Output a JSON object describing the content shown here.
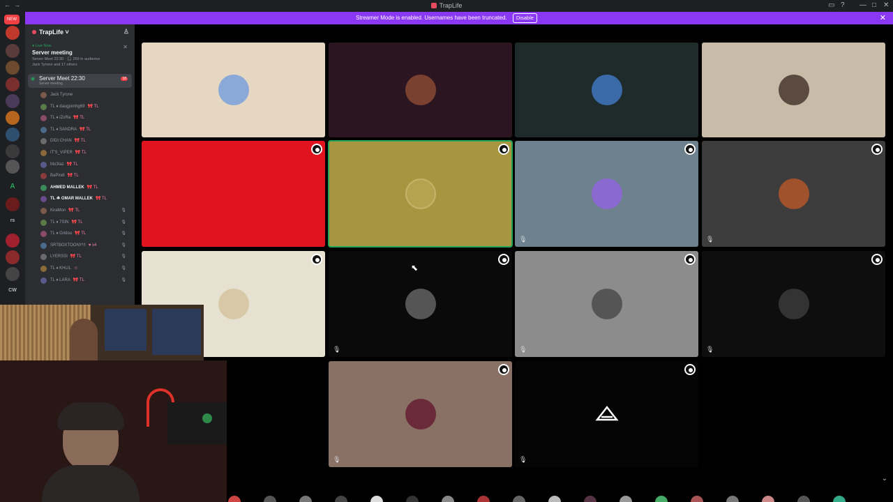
{
  "window": {
    "title": "TrapLife",
    "nav_back": "←",
    "nav_forward": "→",
    "inbox_icon": "inbox-icon",
    "help_icon": "help-icon",
    "minimize": "—",
    "maximize": "□",
    "close": "✕"
  },
  "banner": {
    "text": "Streamer Mode is enabled. Usernames have been truncated.",
    "disable_label": "Disable",
    "close_label": "✕",
    "color": "#8b38f5"
  },
  "server_rail": {
    "new_badge": "NEW",
    "letters": [
      "A",
      "rs",
      "CW"
    ]
  },
  "server": {
    "name": "TrapLife",
    "chevron": "˅",
    "live": {
      "live_now_label": "● Live Now",
      "title": "Server meeting",
      "subtitle": "Server Meet 22:30 · 🎧 269 in audience",
      "speakers": "Jack Tyrone and 17 others",
      "close_label": "✕"
    },
    "voice_channel": {
      "name": "Server Meet 22:30",
      "sub": "Server meeting",
      "badge": "18"
    },
    "members": [
      {
        "name": "Jack Tyrone",
        "tag": ""
      },
      {
        "name": "TL ♦ daugjomhg69",
        "tag": "🎀 TL"
      },
      {
        "name": "TL ♦ iZoRa",
        "tag": "🎀 TL"
      },
      {
        "name": "TL ♦ SANDRA",
        "tag": "🎀 TL"
      },
      {
        "name": "DIDI CHAN",
        "tag": "🎀 TL"
      },
      {
        "name": "IT'S_VIPER",
        "tag": "🎀 TL"
      },
      {
        "name": "Mo3taz",
        "tag": "🎀 TL"
      },
      {
        "name": "BaPindi",
        "tag": "🎀 TL"
      },
      {
        "name": "AHMED MALLEK",
        "tag": "🎀 TL"
      },
      {
        "name": "TL ☘ OMAR MALLEK",
        "tag": "🎀 TL"
      },
      {
        "name": "KiraMon",
        "tag": "🎀 TL"
      },
      {
        "name": "TL ♦ 7SIN",
        "tag": "🎀 TL"
      },
      {
        "name": "TL ♦ Gridou",
        "tag": "🎀 TL"
      },
      {
        "name": "SRTBOXTOONY!!!",
        "tag": "♥ x4"
      },
      {
        "name": "LYERSSI",
        "tag": "🎀 TL"
      },
      {
        "name": "TL ♦ KHLIL",
        "tag": "☺"
      },
      {
        "name": "TL ♦ LARA",
        "tag": "🎀 TL"
      }
    ]
  },
  "tiles_icons": {
    "more": "more-options-icon",
    "muted": "muted-mic-icon"
  },
  "mic_glyph": "🎙",
  "cursor_glyph": "⬉",
  "chevron_down": "⌄"
}
